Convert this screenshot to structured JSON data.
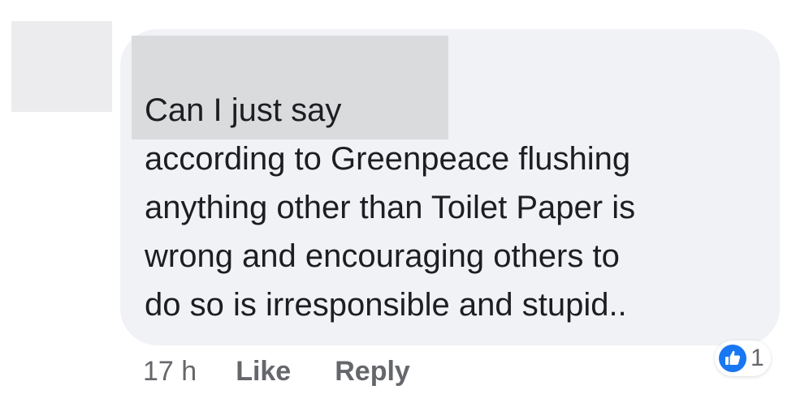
{
  "comment": {
    "text": "Can I just say\naccording to Greenpeace flushing\nanything other than Toilet Paper is\nwrong and encouraging others to\ndo so is irresponsible and stupid..",
    "timestamp": "17 h",
    "like_label": "Like",
    "reply_label": "Reply",
    "reaction": {
      "icon": "thumbs-up-icon",
      "count": "1",
      "color": "#1877f2"
    }
  },
  "colors": {
    "bubble": "#f0f2f5",
    "text": "#1c1e21",
    "meta": "#65676b",
    "redaction": "#dadbdd"
  }
}
